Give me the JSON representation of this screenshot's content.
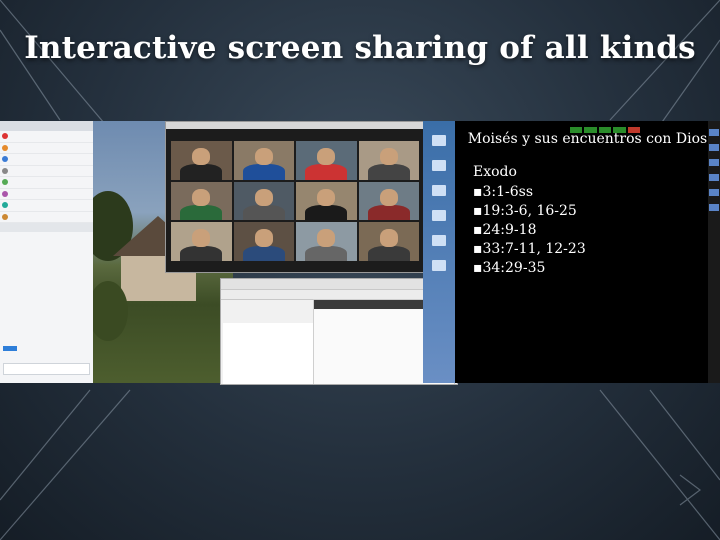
{
  "title": "Interactive screen sharing of all kinds",
  "chat": {
    "participants": [
      "",
      "",
      "",
      "",
      "",
      "",
      "",
      "",
      ""
    ]
  },
  "slide": {
    "title": "Moisés y sus encuentros con Dios",
    "book": "Exodo",
    "refs": [
      "3:1-6ss",
      "19:3-6, 16-25",
      "24:9-18",
      "33:7-11, 12-23",
      "34:29-35"
    ]
  },
  "colors": {
    "title": "#ffffff",
    "background": "#24303d",
    "slide_bg": "#000000"
  }
}
